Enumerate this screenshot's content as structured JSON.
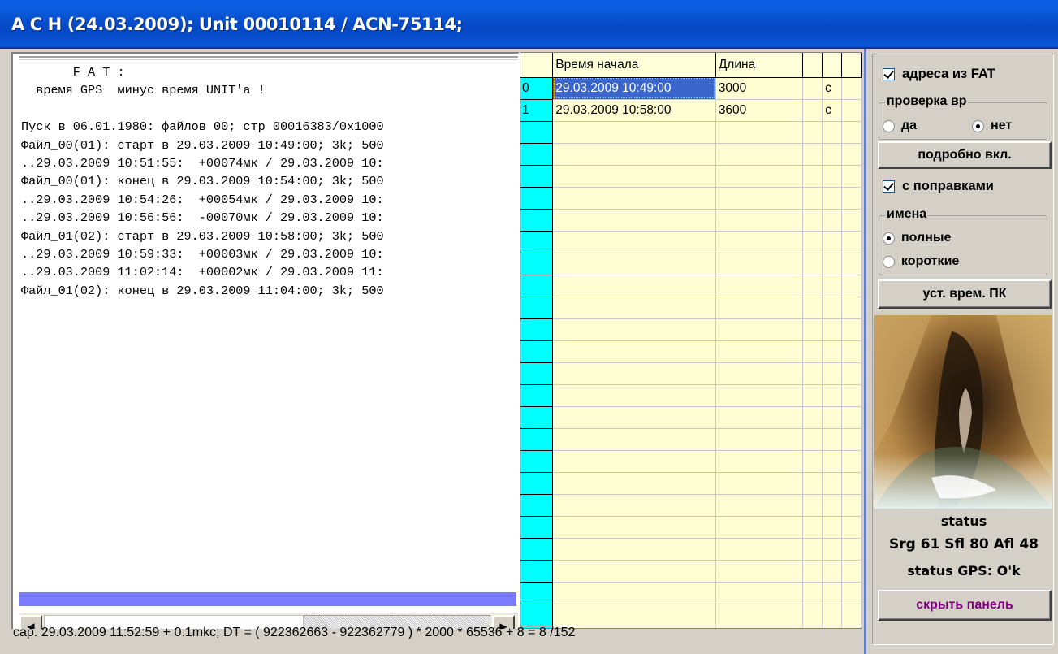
{
  "window": {
    "title": "А С Н (24.03.2009); Unit 00010114 / ACN-75114;"
  },
  "log": {
    "lines": [
      "       F A T :",
      "  время GPS  минус время UNIT'а !",
      "",
      "Пуск в 06.01.1980: файлов 00; стр 00016383/0x1000",
      "Файл_00(01): старт в 29.03.2009 10:49:00; 3k; 500",
      "..29.03.2009 10:51:55:  +00074мк / 29.03.2009 10:",
      "Файл_00(01): конец в 29.03.2009 10:54:00; 3k; 500",
      "..29.03.2009 10:54:26:  +00054мк / 29.03.2009 10:",
      "..29.03.2009 10:56:56:  -00070мк / 29.03.2009 10:",
      "Файл_01(02): старт в 29.03.2009 10:58:00; 3k; 500",
      "..29.03.2009 10:59:33:  +00003мк / 29.03.2009 10:",
      "..29.03.2009 11:02:14:  +00002мк / 29.03.2009 11:",
      "Файл_01(02): конец в 29.03.2009 11:04:00; 3k; 500"
    ]
  },
  "grid": {
    "headers": [
      "",
      "Время начала",
      "Длина",
      "",
      "",
      ""
    ],
    "rows": [
      [
        "0",
        "29.03.2009 10:49:00",
        "3000",
        "",
        "c",
        ""
      ],
      [
        "1",
        "29.03.2009 10:58:00",
        "3600",
        "",
        "c",
        ""
      ]
    ],
    "empty_rows": 24
  },
  "side": {
    "fat_addresses": {
      "label": "адреса из FAT",
      "checked": true
    },
    "time_check": {
      "legend": "проверка вр",
      "yes": "да",
      "no": "нет",
      "selected": "no"
    },
    "detail_button": "подробно вкл.",
    "corrections": {
      "label": "с поправками",
      "checked": true
    },
    "names": {
      "legend": "имена",
      "full": "полные",
      "short": "короткие",
      "selected": "full"
    },
    "set_time_button": "уст. врем. ПК",
    "status_label": "status",
    "status_values": "Srg 61 Sfl 80 Afl 48",
    "status_gps": "status GPS: O'k",
    "hide_button": "скрыть панель",
    "hide_button_color": "#800080"
  },
  "statusbar": {
    "text": "сар. 29.03.2009 11:52:59 + 0.1mkc;  DT = ( 922362663  -  922362779 ) * 2000 * 65536 + 8 = 8 /152"
  },
  "colors": {
    "titlebar": "#0a55d6",
    "grid_bg": "#fefed2",
    "row_header": "#00ffff",
    "selection": "#3a66cc"
  },
  "icons": {
    "scroll_left": "triangle-left",
    "scroll_right": "triangle-right"
  }
}
